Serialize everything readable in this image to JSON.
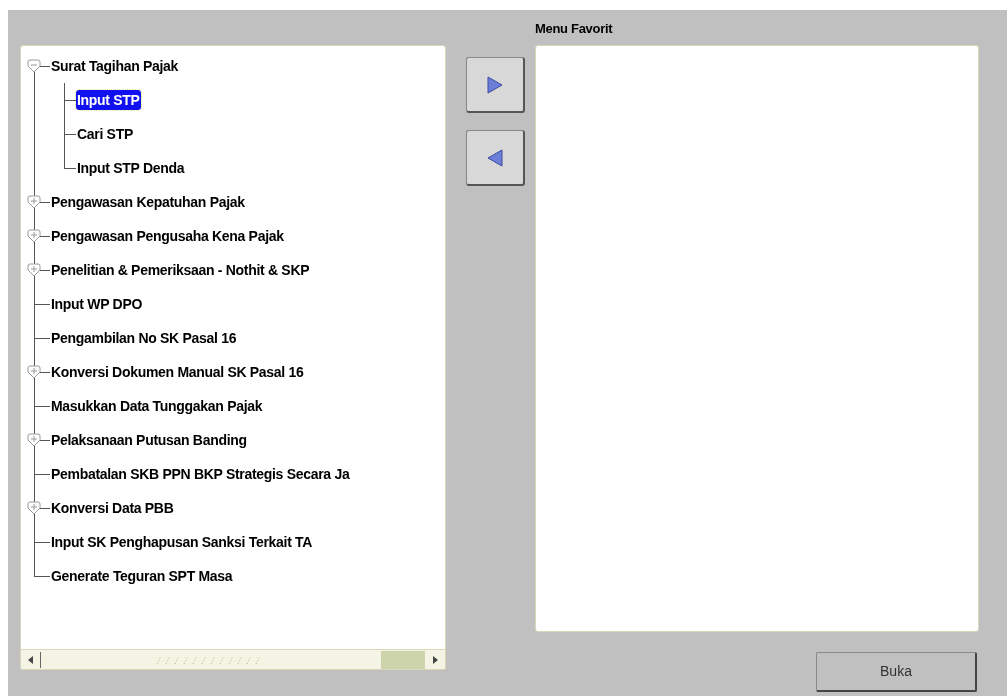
{
  "tree": {
    "items": [
      {
        "label": "Surat Tagihan Pajak",
        "kind": "folder",
        "expanded": true,
        "selected": false,
        "children": [
          {
            "label": "Input STP",
            "selected": true
          },
          {
            "label": "Cari STP",
            "selected": false
          },
          {
            "label": "Input STP Denda",
            "selected": false
          }
        ]
      },
      {
        "label": "Pengawasan Kepatuhan Pajak",
        "kind": "folder",
        "expanded": false,
        "selected": false
      },
      {
        "label": "Pengawasan Pengusaha Kena Pajak",
        "kind": "folder",
        "expanded": false,
        "selected": false
      },
      {
        "label": "Penelitian & Pemeriksaan - Nothit & SKP",
        "kind": "folder",
        "expanded": false,
        "selected": false
      },
      {
        "label": "Input WP DPO",
        "kind": "leaf",
        "selected": false
      },
      {
        "label": "Pengambilan No SK Pasal 16",
        "kind": "leaf",
        "selected": false
      },
      {
        "label": "Konversi Dokumen Manual SK Pasal 16",
        "kind": "folder",
        "expanded": false,
        "selected": false
      },
      {
        "label": "Masukkan Data Tunggakan Pajak",
        "kind": "leaf",
        "selected": false
      },
      {
        "label": "Pelaksanaan Putusan Banding",
        "kind": "folder",
        "expanded": false,
        "selected": false
      },
      {
        "label": "Pembatalan SKB PPN BKP Strategis Secara Ja",
        "kind": "leaf",
        "selected": false
      },
      {
        "label": "Konversi Data PBB",
        "kind": "folder",
        "expanded": false,
        "selected": false
      },
      {
        "label": "Input SK Penghapusan Sanksi Terkait TA",
        "kind": "leaf",
        "selected": false
      },
      {
        "label": "Generate Teguran SPT Masa",
        "kind": "leaf",
        "selected": false
      }
    ]
  },
  "favorites": {
    "title": "Menu Favorit"
  },
  "buttons": {
    "open": "Buka"
  }
}
